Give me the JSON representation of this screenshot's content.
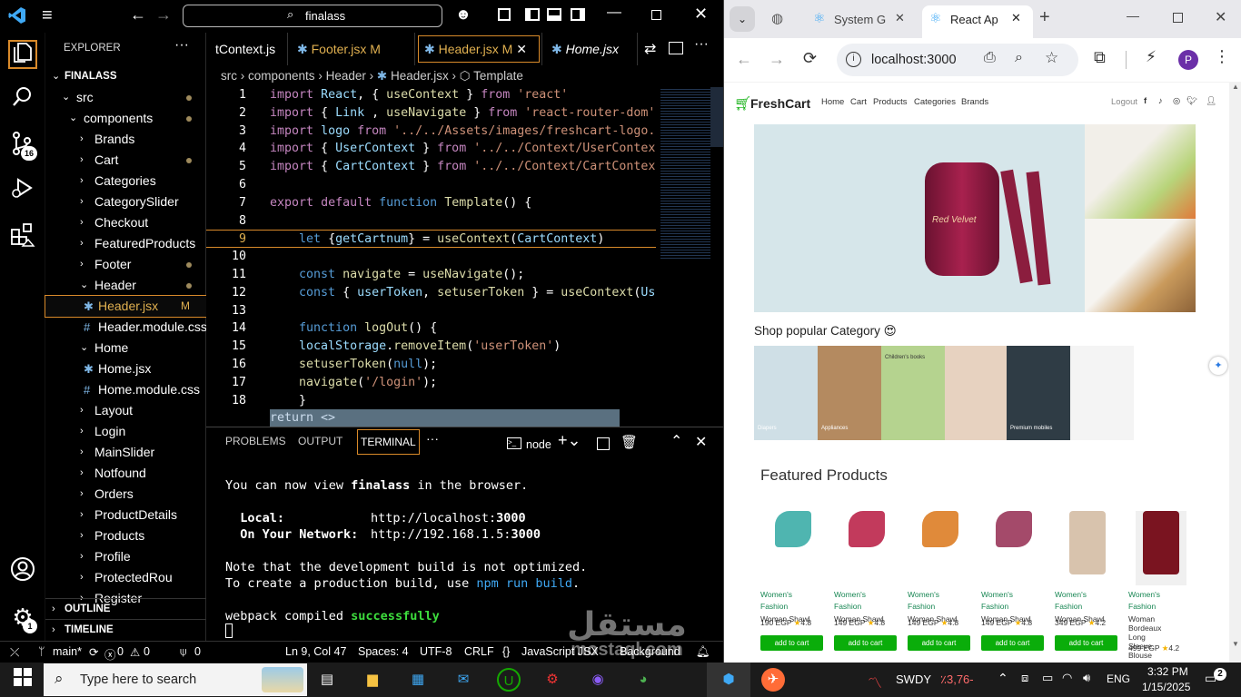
{
  "vscode": {
    "search_text": "finalass",
    "explorer_title": "EXPLORER",
    "project_name": "FINALASS",
    "tree": [
      {
        "label": "src",
        "depth": 1,
        "open": true,
        "dot": true
      },
      {
        "label": "components",
        "depth": 2,
        "open": true,
        "dot": true
      },
      {
        "label": "Brands",
        "depth": 3,
        "open": false
      },
      {
        "label": "Cart",
        "depth": 3,
        "open": false,
        "dot": true
      },
      {
        "label": "Categories",
        "depth": 3,
        "open": false
      },
      {
        "label": "CategorySlider",
        "depth": 3,
        "open": false
      },
      {
        "label": "Checkout",
        "depth": 3,
        "open": false
      },
      {
        "label": "FeaturedProducts",
        "depth": 3,
        "open": false
      },
      {
        "label": "Footer",
        "depth": 3,
        "open": false,
        "dot": true
      },
      {
        "label": "Header",
        "depth": 3,
        "open": true,
        "dot": true
      },
      {
        "label": "Header.jsx",
        "depth": 4,
        "file": "jsx",
        "badge": "M",
        "selected": true
      },
      {
        "label": "Header.module.css",
        "depth": 4,
        "file": "css"
      },
      {
        "label": "Home",
        "depth": 3,
        "open": true
      },
      {
        "label": "Home.jsx",
        "depth": 4,
        "file": "jsx"
      },
      {
        "label": "Home.module.css",
        "depth": 4,
        "file": "css"
      },
      {
        "label": "Layout",
        "depth": 3,
        "open": false
      },
      {
        "label": "Login",
        "depth": 3,
        "open": false
      },
      {
        "label": "MainSlider",
        "depth": 3,
        "open": false
      },
      {
        "label": "Notfound",
        "depth": 3,
        "open": false
      },
      {
        "label": "Orders",
        "depth": 3,
        "open": false
      },
      {
        "label": "ProductDetails",
        "depth": 3,
        "open": false
      },
      {
        "label": "Products",
        "depth": 3,
        "open": false
      },
      {
        "label": "Profile",
        "depth": 3,
        "open": false
      },
      {
        "label": "ProtectedRou",
        "depth": 3,
        "open": false
      },
      {
        "label": "Register",
        "depth": 3,
        "open": false
      }
    ],
    "outline_label": "OUTLINE",
    "timeline_label": "TIMELINE",
    "tabs": [
      {
        "label": "tContext.js",
        "modified": ""
      },
      {
        "label": "Footer.jsx",
        "modified": "M"
      },
      {
        "label": "Header.jsx",
        "modified": "M",
        "active": true
      },
      {
        "label": "Home.jsx",
        "modified": ""
      }
    ],
    "breadcrumb": [
      "src",
      "components",
      "Header",
      "Header.jsx",
      "Template"
    ],
    "code": [
      "import React, { useContext } from 'react'",
      "import { Link , useNavigate } from 'react-router-dom'",
      "import logo from '../../Assets/images/freshcart-logo.",
      "import { UserContext } from '../../Context/UserContex",
      "import { CartContext } from '../../Context/CartContex",
      "",
      "export default function Template() {",
      "",
      "    let {getCartnum} = useContext(CartContext)",
      "",
      "    const navigate = useNavigate();",
      "    const { userToken, setuserToken } = useContext(Us",
      "",
      "    function logOut() {",
      "    localStorage.removeItem('userToken')",
      "    setuserToken(null);",
      "    navigate('/login');",
      "    }",
      "return <>"
    ],
    "panel_tabs": [
      "PROBLEMS",
      "OUTPUT",
      "TERMINAL"
    ],
    "terminal_shell": "node",
    "terminal": {
      "l1a": "You can now view ",
      "l1b": "finalass",
      "l1c": " in the browser.",
      "local_label": "  Local:",
      "local_url": "http://localhost:",
      "local_port": "3000",
      "net_label": "  On Your Network:",
      "net_url": "http://192.168.1.5:",
      "net_port": "3000",
      "note1": "Note that the development build is not optimized.",
      "note2a": "To create a production build, use ",
      "note2b": "npm run build",
      "webpack_a": "webpack compiled ",
      "webpack_b": "successfully"
    },
    "status": {
      "branch": "main*",
      "errors": "0",
      "warnings": "0",
      "ports": "0",
      "position": "Ln 9, Col 47",
      "spaces": "Spaces: 4",
      "encoding": "UTF-8",
      "eol": "CRLF",
      "language": "JavaScript JSX",
      "background": "Background"
    },
    "badge_source_control": "16",
    "badge_settings": "1"
  },
  "browser": {
    "tabs": [
      {
        "label": "System G"
      },
      {
        "label": "React Ap",
        "active": true
      }
    ],
    "url": "localhost:3000",
    "profile": "P",
    "site": {
      "brand": "FreshCart",
      "nav": [
        "Home",
        "Cart",
        "Products",
        "Categories",
        "Brands"
      ],
      "logout": "Logout",
      "popular_heading": "Shop popular Category",
      "categories": [
        {
          "label": "Diapers",
          "color": "#cfdfe6"
        },
        {
          "label": "Appliances",
          "color": "#b48a60"
        },
        {
          "label": "Children's books",
          "color": "#b5d38f"
        },
        {
          "label": "",
          "color": "#e7d2c0"
        },
        {
          "label": "Premium mobiles",
          "color": "#2f3c45"
        },
        {
          "label": "",
          "color": "#f4f4f4"
        },
        {
          "label": "",
          "color": "#ffffff"
        }
      ],
      "featured_heading": "Featured Products",
      "products": [
        {
          "category": "Women's Fashion",
          "name": "Woman Shawl",
          "price": "190 EGP",
          "rating": "4.8"
        },
        {
          "category": "Women's Fashion",
          "name": "Woman Shawl",
          "price": "149 EGP",
          "rating": "4.8"
        },
        {
          "category": "Women's Fashion",
          "name": "Woman Shawl",
          "price": "149 EGP",
          "rating": "4.8"
        },
        {
          "category": "Women's Fashion",
          "name": "Woman Shawl",
          "price": "149 EGP",
          "rating": "4.8"
        },
        {
          "category": "Women's Fashion",
          "name": "Woman Shawl",
          "price": "349 EGP",
          "rating": "4.2"
        },
        {
          "category": "Women's Fashion",
          "name": "Woman Bordeaux Long Sleeve Blouse",
          "price": "499 EGP",
          "rating": "4.2"
        }
      ],
      "add_to_cart": "add to cart",
      "slider_caption": "Red Velvet"
    }
  },
  "taskbar": {
    "search_placeholder": "Type here to search",
    "stock_name": "SWDY",
    "stock_change": "٪3,76-",
    "lang": "ENG",
    "time": "3:32 PM",
    "date": "1/15/2025",
    "notif_count": "2"
  },
  "watermark": {
    "arabic": "مستقل",
    "latin": "mostaql.com"
  },
  "colors": {
    "vscode_bg": "#000000",
    "brand_green": "#0aad0a",
    "link_blue": "#569cd6",
    "keyword_purple": "#c586c0",
    "string": "#ce9178"
  }
}
